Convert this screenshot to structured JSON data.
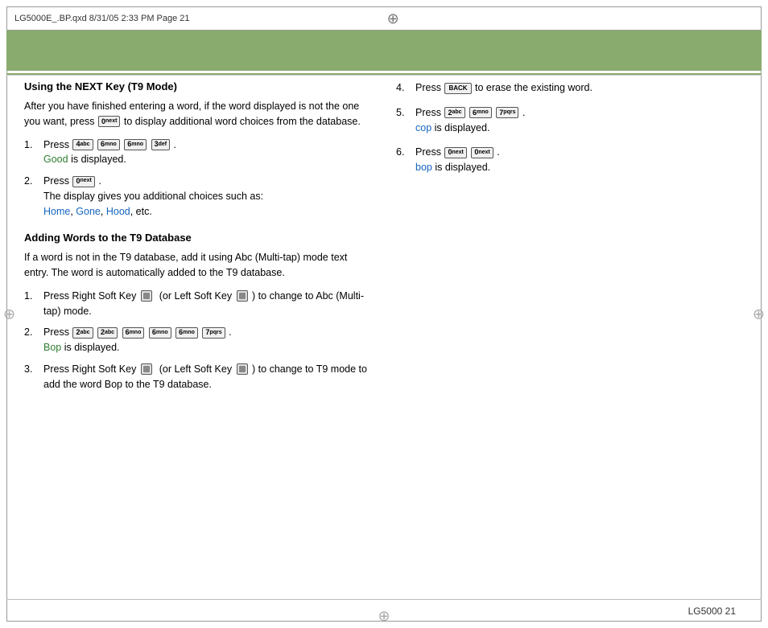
{
  "header": {
    "file_info": "LG5000E_.BP.qxd   8/31/05   2:33 PM   Page 21"
  },
  "left_column": {
    "section1": {
      "title": "Using the NEXT Key (T9 Mode)",
      "intro": "After you have finished entering a word, if the word displayed is not the one you want, press",
      "next_key": "0",
      "next_key_label": "next",
      "intro_end": "to display additional word choices from the database.",
      "items": [
        {
          "number": "1.",
          "press_label": "Press",
          "keys": [
            "4abc",
            "6mno",
            "6mno",
            "3def"
          ],
          "period": ".",
          "colored_word": "Good",
          "colored_class": "color-good",
          "suffix": "is displayed."
        },
        {
          "number": "2.",
          "press_label": "Press",
          "keys": [
            "0next"
          ],
          "period": ".",
          "body": "The display gives you additional choices such as:",
          "colored_words": [
            "Home",
            "Gone",
            "Hood"
          ],
          "colored_suffix": ", etc."
        }
      ]
    },
    "section2": {
      "title": "Adding Words to the T9 Database",
      "intro": "If a word is not in the T9 database, add it using Abc (Multi-tap) mode text entry. The word is automatically added to the T9 database.",
      "items": [
        {
          "number": "1.",
          "text": "Press Right Soft Key",
          "or_text": "(or Left Soft Key",
          "suffix": ") to change to Abc (Multi-tap) mode."
        },
        {
          "number": "2.",
          "press_label": "Press",
          "keys": [
            "2abc",
            "2abc",
            "6mno",
            "6mno",
            "6mno",
            "7pqrs"
          ],
          "period": ".",
          "colored_word": "Bop",
          "colored_class": "color-bop",
          "suffix": "is displayed."
        },
        {
          "number": "3.",
          "text": "Press Right Soft Key",
          "or_text": "(or Left Soft Key",
          "suffix": ") to change to T9 mode to add the word Bop to the T9 database."
        }
      ]
    }
  },
  "right_column": {
    "items": [
      {
        "number": "4.",
        "press_label": "Press",
        "keys": [
          "back"
        ],
        "text": "to erase the existing word."
      },
      {
        "number": "5.",
        "press_label": "Press",
        "keys": [
          "2abc",
          "6mno",
          "7pqrs"
        ],
        "period": ".",
        "colored_word": "cop",
        "colored_class": "color-blue",
        "suffix": "is displayed."
      },
      {
        "number": "6.",
        "press_label": "Press",
        "keys": [
          "0next",
          "0next"
        ],
        "period": ".",
        "colored_word": "bop",
        "colored_class": "color-blue",
        "suffix": "is displayed."
      }
    ]
  },
  "footer": {
    "text": "LG5000  21"
  }
}
